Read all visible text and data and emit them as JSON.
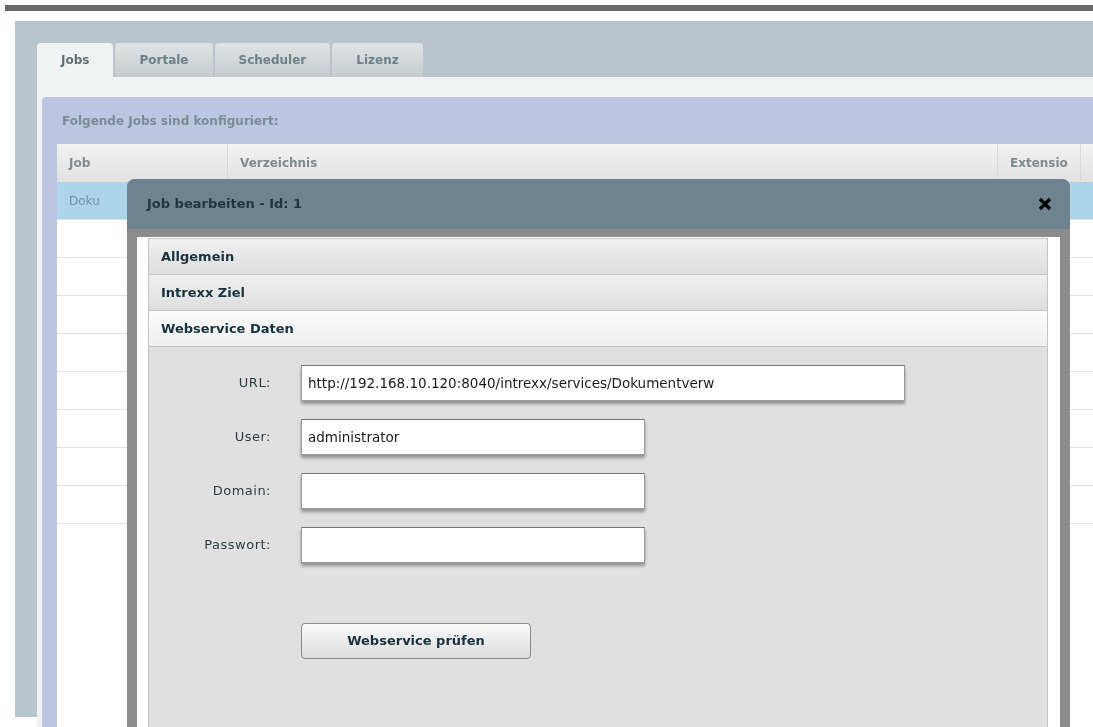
{
  "tabs": [
    {
      "label": "Jobs",
      "selected": true
    },
    {
      "label": "Portale",
      "selected": false
    },
    {
      "label": "Scheduler",
      "selected": false
    },
    {
      "label": "Lizenz",
      "selected": false
    }
  ],
  "jobs_panel": {
    "title": "Folgende Jobs sind konfiguriert:",
    "table": {
      "columns": [
        "Job",
        "Verzeichnis",
        "Extensio"
      ],
      "rows": [
        {
          "cells": [
            "Doku"
          ],
          "selected": true
        }
      ]
    }
  },
  "dialog": {
    "title": "Job bearbeiten - Id: 1",
    "sections": [
      {
        "label": "Allgemein",
        "expanded": false
      },
      {
        "label": "Intrexx Ziel",
        "expanded": false
      },
      {
        "label": "Webservice Daten",
        "expanded": true
      }
    ],
    "fields": [
      {
        "label": "URL:",
        "value": "http://192.168.10.120:8040/intrexx/services/Dokumentverw",
        "wide": true
      },
      {
        "label": "User:",
        "value": "administrator",
        "wide": false
      },
      {
        "label": "Domain:",
        "wide": false
      },
      {
        "label": "Passwort:",
        "wide": false
      }
    ],
    "button": "Webservice prüfen"
  }
}
